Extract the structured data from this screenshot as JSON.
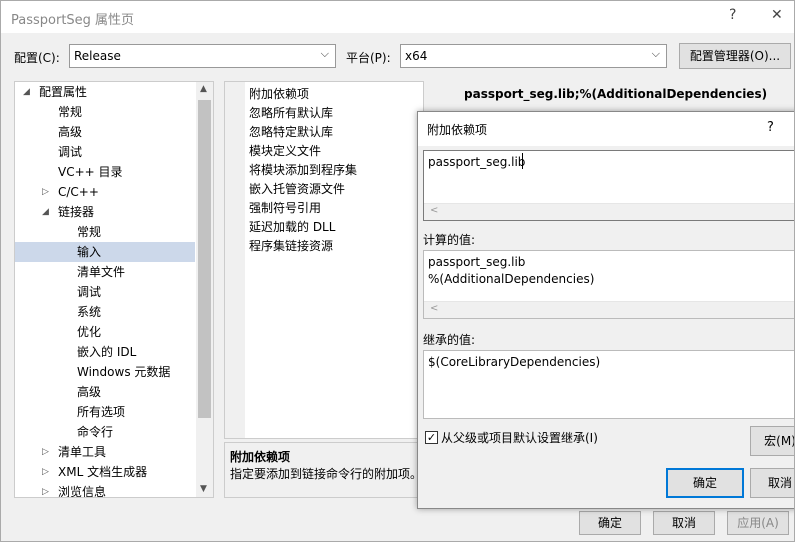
{
  "window": {
    "title": "PassportSeg 属性页",
    "help_glyph": "?",
    "close_glyph": "✕"
  },
  "toolbar": {
    "config_label": "配置(C):",
    "config_value": "Release",
    "platform_label": "平台(P):",
    "platform_value": "x64",
    "config_manager_label": "配置管理器(O)..."
  },
  "tree": {
    "items": [
      {
        "label": "配置属性",
        "expander": "◢"
      },
      {
        "label": "常规"
      },
      {
        "label": "高级"
      },
      {
        "label": "调试"
      },
      {
        "label": "VC++ 目录"
      },
      {
        "label": "C/C++",
        "expander": "▷"
      },
      {
        "label": "链接器",
        "expander": "◢"
      },
      {
        "label": "常规"
      },
      {
        "label": "输入"
      },
      {
        "label": "清单文件"
      },
      {
        "label": "调试"
      },
      {
        "label": "系统"
      },
      {
        "label": "优化"
      },
      {
        "label": "嵌入的 IDL"
      },
      {
        "label": "Windows 元数据"
      },
      {
        "label": "高级"
      },
      {
        "label": "所有选项"
      },
      {
        "label": "命令行"
      },
      {
        "label": "清单工具",
        "expander": "▷"
      },
      {
        "label": "XML 文档生成器",
        "expander": "▷"
      },
      {
        "label": "浏览信息",
        "expander": "▷"
      }
    ],
    "selected": "输入",
    "scroll_up": "▲",
    "scroll_down": "▼"
  },
  "grid": {
    "rows": [
      "附加依赖项",
      "忽略所有默认库",
      "忽略特定默认库",
      "模块定义文件",
      "将模块添加到程序集",
      "嵌入托管资源文件",
      "强制符号引用",
      "延迟加载的 DLL",
      "程序集链接资源"
    ],
    "first_value": "passport_seg.lib;%(AdditionalDependencies)"
  },
  "description": {
    "title": "附加依赖项",
    "text": "指定要添加到链接命令行的附加项。"
  },
  "dialog": {
    "title": "附加依赖项",
    "help_glyph": "?",
    "edit_value": "passport_seg.lib",
    "scroll_left": "<",
    "computed_label": "计算的值:",
    "computed_lines": [
      "passport_seg.lib",
      "%(AdditionalDependencies)"
    ],
    "inherited_label": "继承的值:",
    "inherited_value": "$(CoreLibraryDependencies)",
    "inherit_checkbox_label": "从父级或项目默认设置继承(I)",
    "inherit_checked": true,
    "check_glyph": "✓",
    "macro_button": "宏(M)",
    "ok_button": "确定",
    "cancel_button": "取消"
  },
  "footer": {
    "ok": "确定",
    "cancel": "取消",
    "apply": "应用(A)"
  },
  "colors": {
    "selection": "#ccd8ea",
    "ok_border": "#0078d7"
  }
}
